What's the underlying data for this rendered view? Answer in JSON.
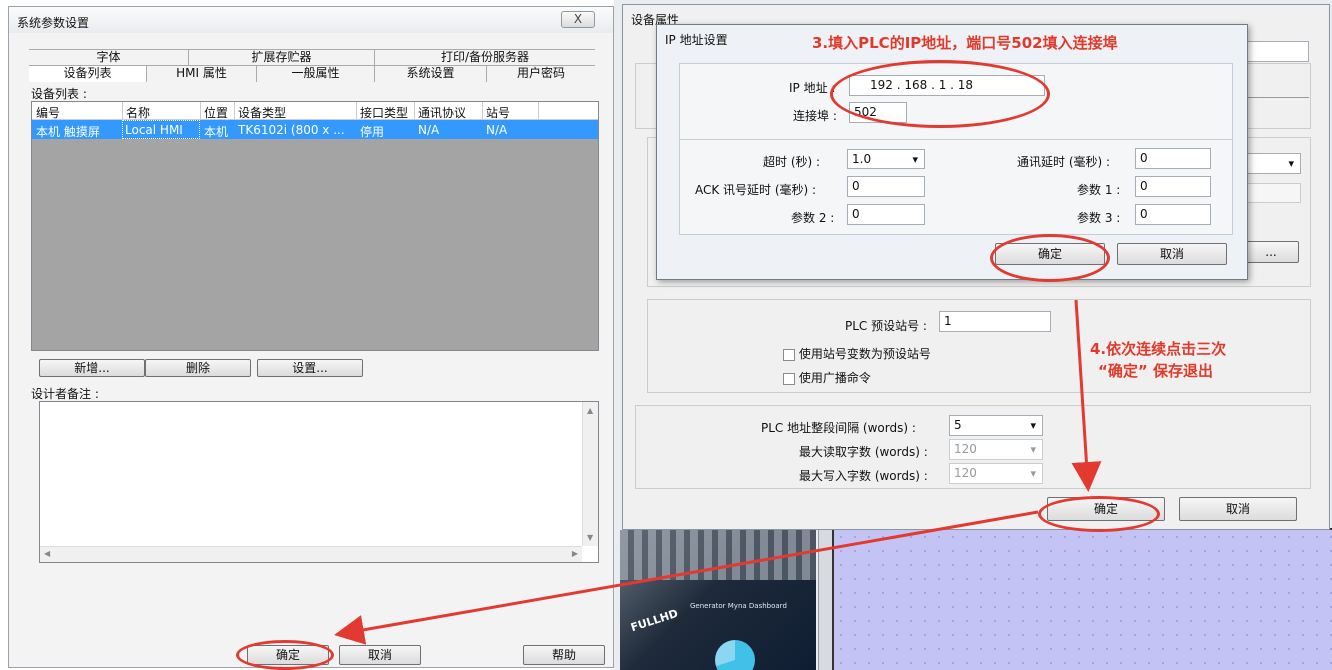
{
  "system_dialog": {
    "title": "系统参数设置",
    "close_label": "X",
    "tabs_row1": [
      "字体",
      "扩展存贮器",
      "打印/备份服务器"
    ],
    "tabs_row2": [
      "设备列表",
      "HMI 属性",
      "一般属性",
      "系统设置",
      "用户密码"
    ],
    "device_list_label": "设备列表 :",
    "columns": [
      "编号",
      "名称",
      "位置",
      "设备类型",
      "接口类型",
      "通讯协议",
      "站号"
    ],
    "row": [
      "本机 触摸屏",
      "Local HMI",
      "本机",
      "TK6102i (800 x ...",
      "停用",
      "N/A",
      "N/A"
    ],
    "buttons": {
      "add": "新增...",
      "delete": "删除",
      "settings": "设置..."
    },
    "notes_label": "设计者备注 :",
    "ok": "确定",
    "cancel": "取消",
    "help": "帮助"
  },
  "device_props": {
    "title": "设备属性",
    "plc_station_label": "PLC 预设站号 :",
    "plc_station_value": "1",
    "use_station_var": "使用站号变数为预设站号",
    "use_broadcast": "使用广播命令",
    "addr_interval_label": "PLC 地址整段间隔 (words) :",
    "addr_interval_value": "5",
    "max_read_label": "最大读取字数 (words) :",
    "max_read_value": "120",
    "max_write_label": "最大写入字数 (words) :",
    "max_write_value": "120",
    "ok": "确定",
    "cancel": "取消",
    "ellipsis": "..."
  },
  "ip_dialog": {
    "title": "IP 地址设置",
    "ip_label": "IP 地址 :",
    "ip_value": "192 . 168 . 1 . 18",
    "port_label": "连接埠 :",
    "port_value": "502",
    "timeout_label": "超时 (秒) :",
    "timeout_value": "1.0",
    "comm_delay_label": "通讯延时 (毫秒) :",
    "comm_delay_value": "0",
    "ack_delay_label": "ACK 讯号延时 (毫秒) :",
    "ack_delay_value": "0",
    "param1_label": "参数 1 :",
    "param1_value": "0",
    "param2_label": "参数 2 :",
    "param2_value": "0",
    "param3_label": "参数 3 :",
    "param3_value": "0",
    "ok": "确定",
    "cancel": "取消"
  },
  "annotations": {
    "step3": "3.填入PLC的IP地址，端口号502填入连接埠",
    "step4_line1": "4.依次连续点击三次",
    "step4_line2": "“确定” 保存退出"
  },
  "background": {
    "thumb_text": "Generator Myna Dashboard",
    "logo_text": "FULLHD"
  },
  "colors": {
    "annotation_red": "#e03a2b",
    "selection_blue": "#3399ff",
    "canvas_purple": "#c4c4f4"
  }
}
